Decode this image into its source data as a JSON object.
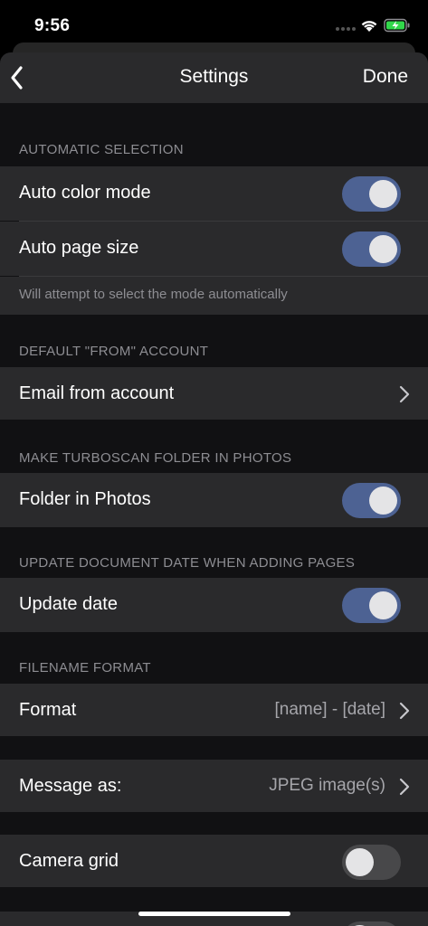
{
  "status_bar": {
    "time": "9:56"
  },
  "nav": {
    "title": "Settings",
    "done_label": "Done"
  },
  "sections": {
    "automatic_selection": {
      "header": "AUTOMATIC SELECTION",
      "auto_color": {
        "label": "Auto color mode",
        "on": true
      },
      "auto_page": {
        "label": "Auto page size",
        "on": true
      },
      "footer": "Will attempt to select the mode automatically"
    },
    "default_from": {
      "header": "DEFAULT \"FROM\" ACCOUNT",
      "email_from": {
        "label": "Email from account"
      }
    },
    "folder": {
      "header": "MAKE TURBOSCAN FOLDER IN PHOTOS",
      "folder_in_photos": {
        "label": "Folder in Photos",
        "on": true
      }
    },
    "update": {
      "header": "UPDATE DOCUMENT DATE WHEN ADDING PAGES",
      "update_date": {
        "label": "Update date",
        "on": true
      }
    },
    "filename": {
      "header": "FILENAME FORMAT",
      "format": {
        "label": "Format",
        "value": "[name] - [date]"
      }
    },
    "message": {
      "label": "Message as:",
      "value": "JPEG image(s)"
    },
    "camera": {
      "label": "Camera grid",
      "on": false
    }
  },
  "colors": {
    "toggle_on": "#4d6293",
    "toggle_off": "#48484a",
    "row_bg": "#2a2a2c",
    "page_bg": "#111113"
  }
}
